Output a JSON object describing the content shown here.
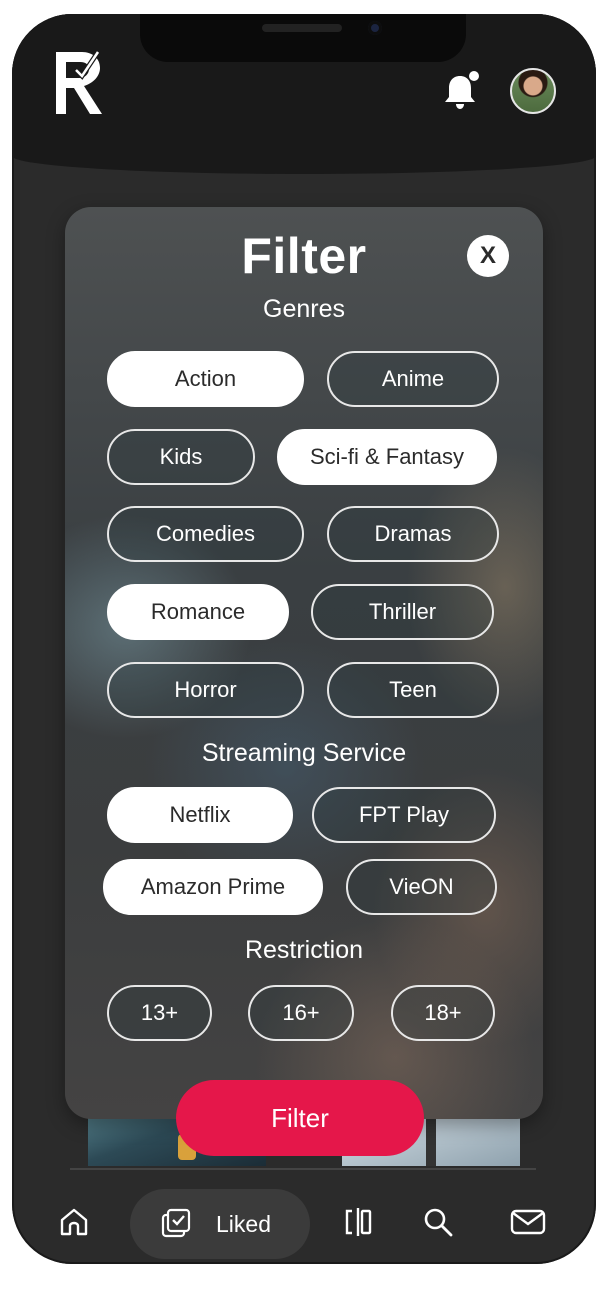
{
  "modal": {
    "title": "Filter",
    "close_label": "X",
    "sections": {
      "genres": "Genres",
      "streaming": "Streaming Service",
      "restriction": "Restriction"
    },
    "genres": [
      {
        "label": "Action",
        "selected": true
      },
      {
        "label": "Anime",
        "selected": false
      },
      {
        "label": "Kids",
        "selected": false
      },
      {
        "label": "Sci-fi & Fantasy",
        "selected": true
      },
      {
        "label": "Comedies",
        "selected": false
      },
      {
        "label": "Dramas",
        "selected": false
      },
      {
        "label": "Romance",
        "selected": true
      },
      {
        "label": "Thriller",
        "selected": false
      },
      {
        "label": "Horror",
        "selected": false
      },
      {
        "label": "Teen",
        "selected": false
      }
    ],
    "streaming": [
      {
        "label": "Netflix",
        "selected": true
      },
      {
        "label": "FPT Play",
        "selected": false
      },
      {
        "label": "Amazon Prime",
        "selected": true
      },
      {
        "label": "VieON",
        "selected": false
      }
    ],
    "restrictions": [
      {
        "label": "13+",
        "selected": false
      },
      {
        "label": "16+",
        "selected": false
      },
      {
        "label": "18+",
        "selected": false
      }
    ],
    "submit_label": "Filter"
  },
  "bottom_nav": {
    "liked_label": "Liked"
  },
  "colors": {
    "accent": "#e5174a",
    "background": "#2b2b2b",
    "header": "#191919"
  },
  "icons": [
    "logo-icon",
    "bell-icon",
    "avatar",
    "home-icon",
    "liked-icon",
    "compare-icon",
    "search-icon",
    "mail-icon"
  ]
}
